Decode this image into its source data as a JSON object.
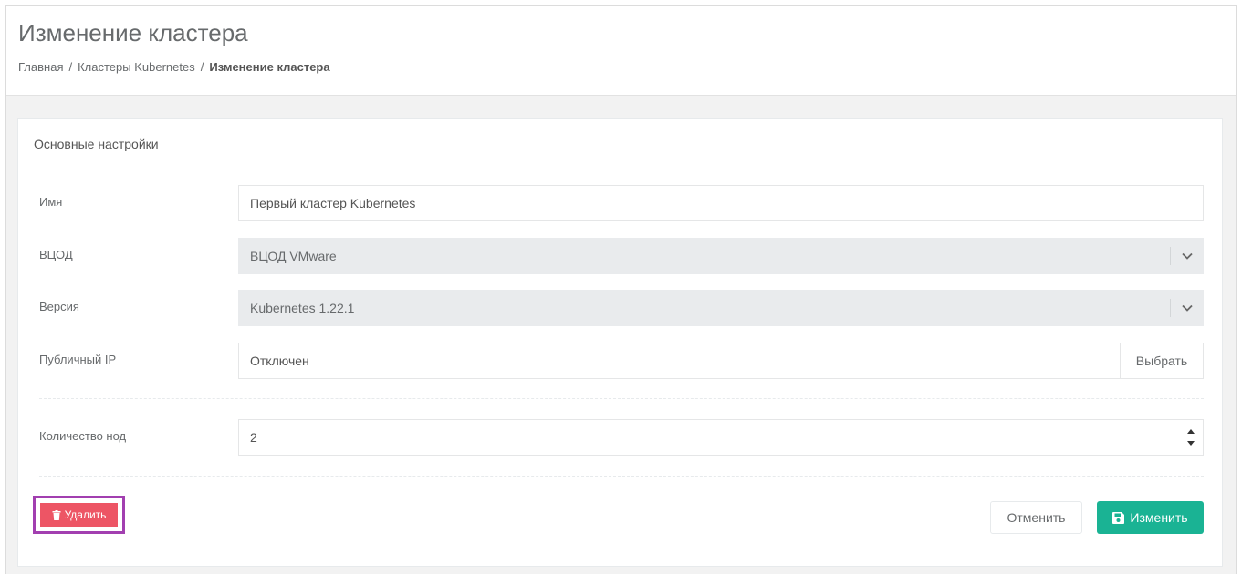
{
  "header": {
    "title": "Изменение кластера",
    "breadcrumb": [
      {
        "label": "Главная"
      },
      {
        "label": "Кластеры Kubernetes"
      },
      {
        "label": "Изменение кластера"
      }
    ],
    "separator": "/"
  },
  "panel": {
    "heading": "Основные настройки",
    "fields": {
      "name": {
        "label": "Имя",
        "value": "Первый кластер Kubernetes"
      },
      "vdc": {
        "label": "ВЦОД",
        "value": "ВЦОД VMware"
      },
      "version": {
        "label": "Версия",
        "value": "Kubernetes 1.22.1"
      },
      "public_ip": {
        "label": "Публичный IP",
        "value": "Отключен",
        "button": "Выбрать"
      },
      "node_count": {
        "label": "Количество нод",
        "value": "2"
      }
    },
    "actions": {
      "delete": "Удалить",
      "cancel": "Отменить",
      "save": "Изменить"
    }
  },
  "colors": {
    "delete": "#ed5565",
    "save": "#1ab394",
    "highlight": "#a23fb0"
  }
}
